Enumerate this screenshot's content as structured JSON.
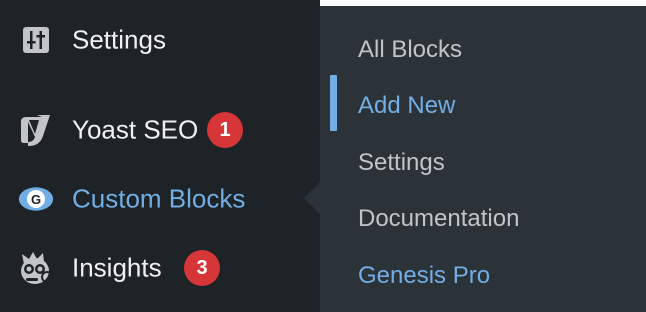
{
  "sidebar": {
    "items": [
      {
        "label": "Settings",
        "icon": "settings-sliders-icon"
      },
      {
        "label": "Yoast SEO",
        "icon": "yoast-icon",
        "badge": "1"
      },
      {
        "label": "Custom Blocks",
        "icon": "custom-blocks-icon",
        "icon_letter": "G",
        "current": true
      },
      {
        "label": "Insights",
        "icon": "insights-mascot-icon",
        "badge": "3"
      }
    ]
  },
  "submenu": {
    "items": [
      {
        "label": "All Blocks"
      },
      {
        "label": "Add New",
        "active": true
      },
      {
        "label": "Settings"
      },
      {
        "label": "Documentation"
      },
      {
        "label": "Genesis Pro",
        "highlight": true
      }
    ]
  },
  "colors": {
    "sidebar_bg": "#1d2327",
    "submenu_bg": "#2c3338",
    "text": "#f0f0f1",
    "sub_text": "#c3c4c7",
    "accent": "#72aee6",
    "badge": "#d63638"
  }
}
